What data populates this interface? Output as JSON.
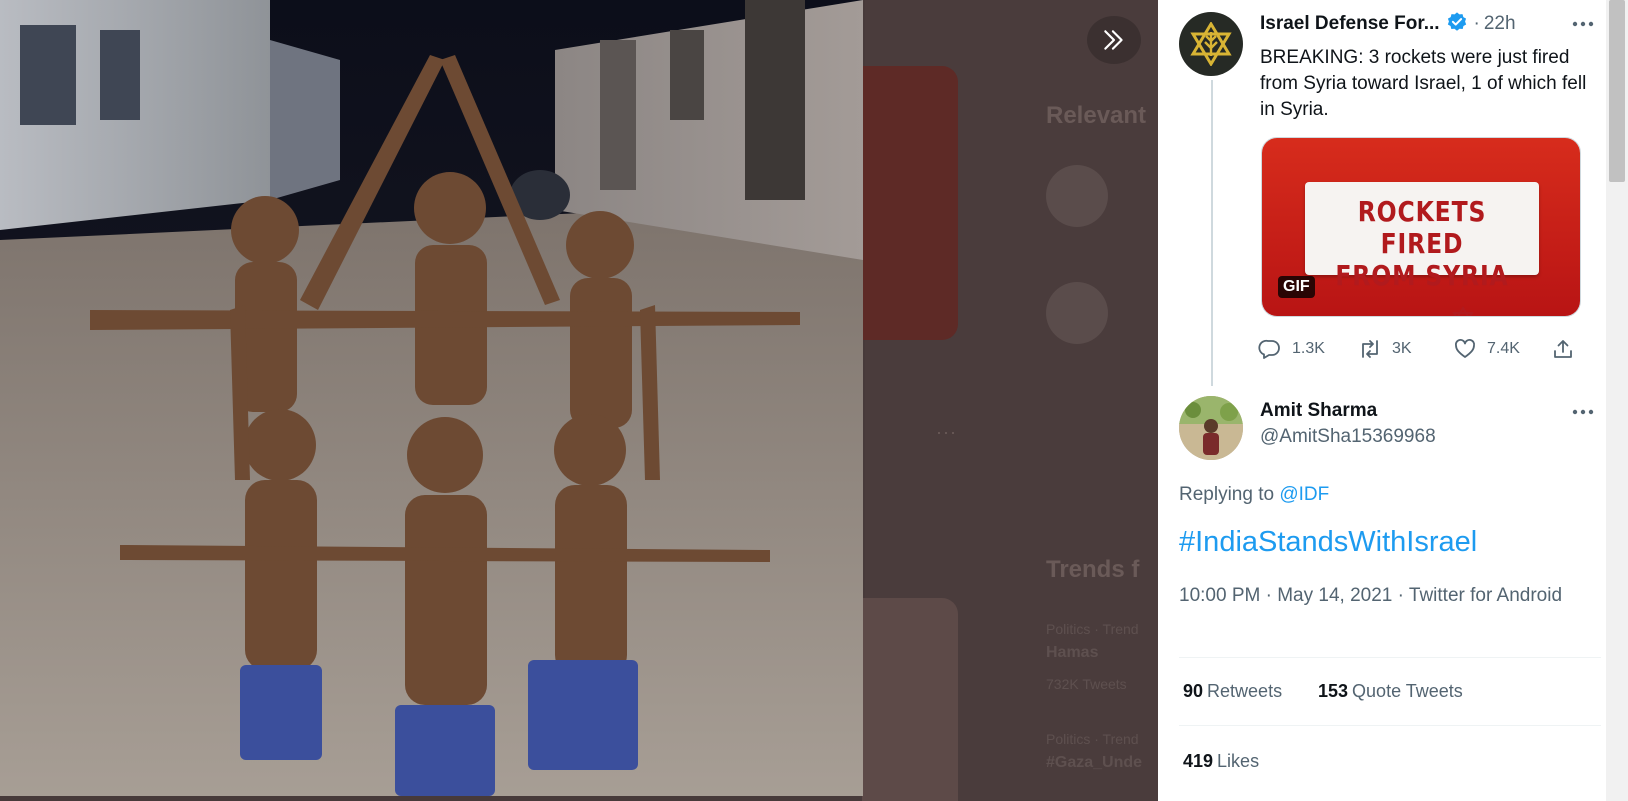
{
  "media_viewer": {
    "expand_icon": "double-chevron-right-icon",
    "background": {
      "heading_1": "Relevant",
      "heading_2": "Trends f",
      "trend_1_category": "Politics · Trend",
      "trend_1_name": "Hamas",
      "trend_1_count": "732K Tweets",
      "trend_2_category": "Politics · Trend",
      "trend_2_name": "#Gaza_Unde"
    }
  },
  "tweet": {
    "author_name": "Israel Defense For...",
    "verified": true,
    "separator": "·",
    "time": "22h",
    "more_icon": "more-horizontal-icon",
    "text": "BREAKING: 3 rockets were just fired from Syria toward Israel, 1 of which fell in Syria.",
    "gif": {
      "line_1": "ROCKETS FIRED",
      "line_2": "FROM SYRIA",
      "badge": "GIF"
    },
    "actions": {
      "reply_count": "1.3K",
      "retweet_count": "3K",
      "like_count": "7.4K"
    }
  },
  "reply": {
    "author_name": "Amit Sharma",
    "handle": "@AmitSha15369968",
    "replying_prefix": "Replying to",
    "replying_to": "@IDF",
    "text": "#IndiaStandsWithIsrael",
    "timestamp": "10:00 PM · May 14, 2021 · Twitter for Android",
    "stats": {
      "retweets_value": "90",
      "retweets_label": "Retweets",
      "quotes_value": "153",
      "quotes_label": "Quote Tweets",
      "likes_value": "419",
      "likes_label": "Likes"
    }
  },
  "colors": {
    "accent": "#1d9bf0",
    "text_primary": "#0f1419",
    "text_secondary": "#536471",
    "gif_red": "#c8201a"
  }
}
